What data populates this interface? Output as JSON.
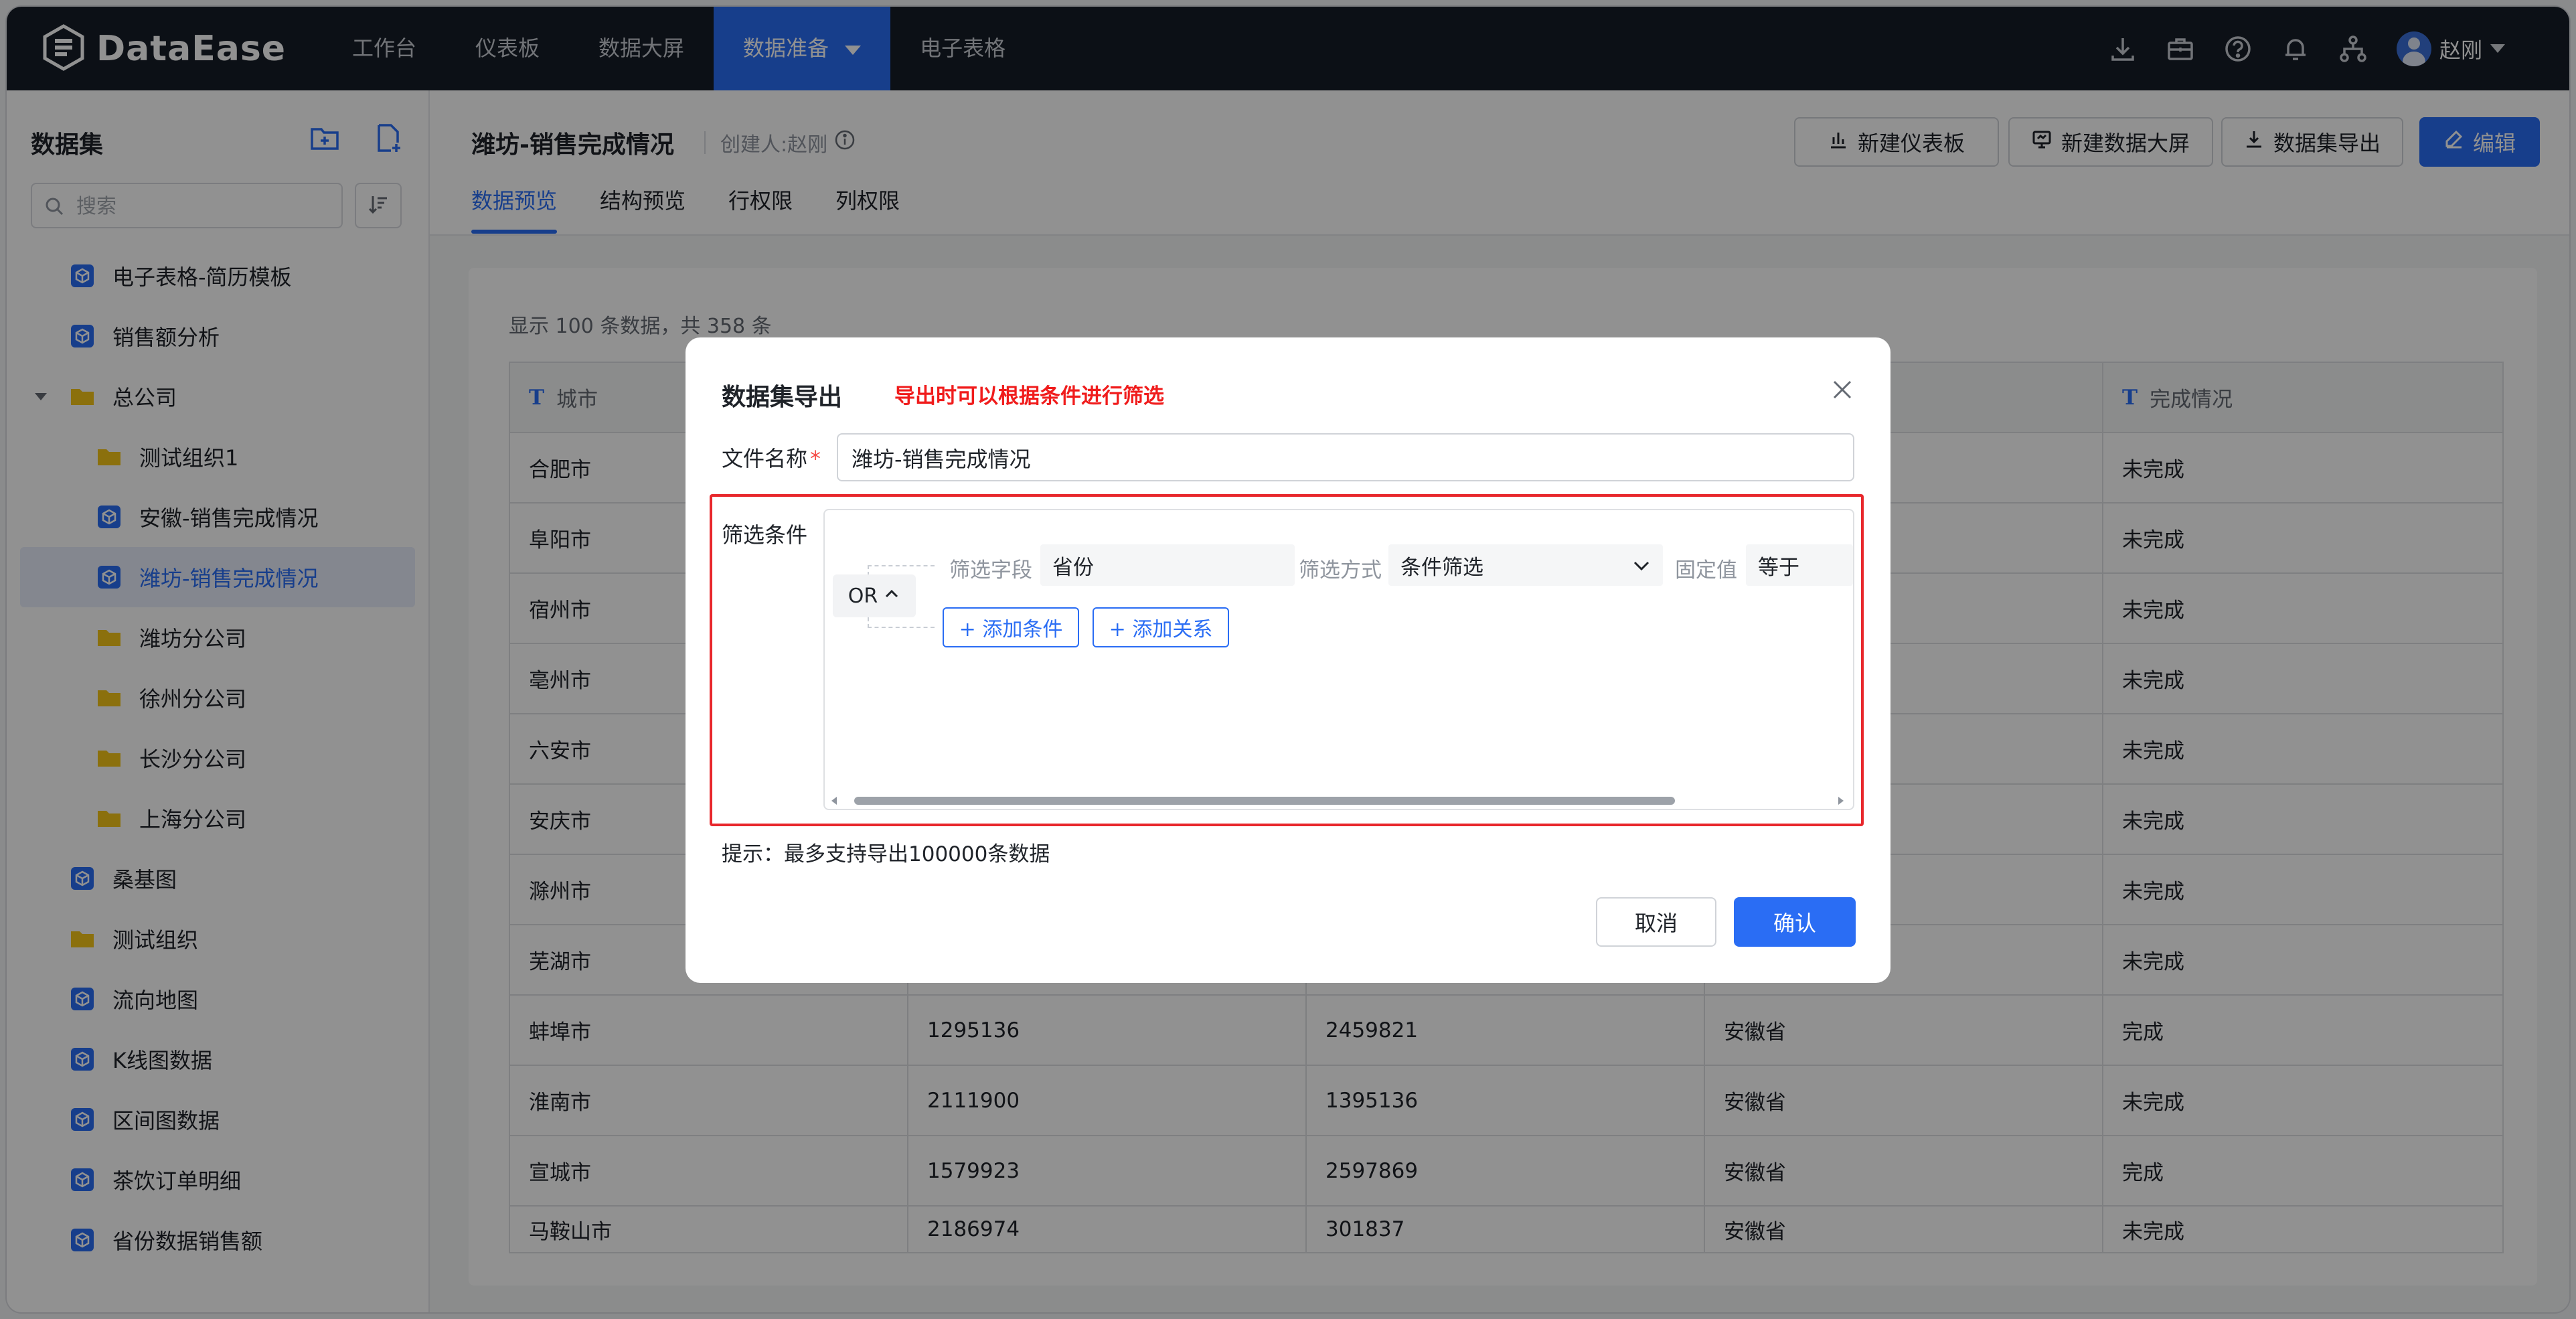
{
  "brand": {
    "name": "DataEase"
  },
  "nav": {
    "items": [
      "工作台",
      "仪表板",
      "数据大屏",
      "数据准备",
      "电子表格"
    ],
    "active_index": 3
  },
  "user": {
    "name": "赵刚"
  },
  "top_icons": [
    "download-icon",
    "briefcase-icon",
    "help-icon",
    "bell-icon",
    "org-tree-icon"
  ],
  "sidebar": {
    "title": "数据集",
    "search_placeholder": "搜索",
    "items": [
      {
        "label": "电子表格-简历模板",
        "type": "dataset",
        "level": 0
      },
      {
        "label": "销售额分析",
        "type": "dataset",
        "level": 0
      },
      {
        "label": "总公司",
        "type": "folder",
        "level": 0,
        "expanded": true
      },
      {
        "label": "测试组织1",
        "type": "folder",
        "level": 1
      },
      {
        "label": "安徽-销售完成情况",
        "type": "dataset",
        "level": 1
      },
      {
        "label": "潍坊-销售完成情况",
        "type": "dataset",
        "level": 1,
        "selected": true
      },
      {
        "label": "潍坊分公司",
        "type": "folder",
        "level": 1
      },
      {
        "label": "徐州分公司",
        "type": "folder",
        "level": 1
      },
      {
        "label": "长沙分公司",
        "type": "folder",
        "level": 1
      },
      {
        "label": "上海分公司",
        "type": "folder",
        "level": 1
      },
      {
        "label": "桑基图",
        "type": "dataset",
        "level": 0
      },
      {
        "label": "测试组织",
        "type": "folder",
        "level": 0
      },
      {
        "label": "流向地图",
        "type": "dataset",
        "level": 0
      },
      {
        "label": "K线图数据",
        "type": "dataset",
        "level": 0
      },
      {
        "label": "区间图数据",
        "type": "dataset",
        "level": 0
      },
      {
        "label": "茶饮订单明细",
        "type": "dataset",
        "level": 0
      },
      {
        "label": "省份数据销售额",
        "type": "dataset",
        "level": 0
      }
    ]
  },
  "dataset": {
    "title": "潍坊-销售完成情况",
    "creator": "创建人:赵刚",
    "buttons": {
      "new_dashboard": "新建仪表板",
      "new_screen": "新建数据大屏",
      "export": "数据集导出",
      "edit": "编辑"
    },
    "tabs": [
      "数据预览",
      "结构预览",
      "行权限",
      "列权限"
    ],
    "active_tab": 0
  },
  "preview": {
    "count_text": "显示 100 条数据，共 358 条",
    "columns": [
      "城市",
      "",
      "",
      "",
      "完成情况"
    ],
    "rows": [
      [
        "合肥市",
        "",
        "",
        "",
        "未完成"
      ],
      [
        "阜阳市",
        "",
        "",
        "",
        "未完成"
      ],
      [
        "宿州市",
        "",
        "",
        "",
        "未完成"
      ],
      [
        "亳州市",
        "",
        "",
        "",
        "未完成"
      ],
      [
        "六安市",
        "",
        "",
        "",
        "未完成"
      ],
      [
        "安庆市",
        "",
        "",
        "",
        "未完成"
      ],
      [
        "滁州市",
        "",
        "",
        "",
        "未完成"
      ],
      [
        "芜湖市",
        "",
        "",
        "",
        "未完成"
      ],
      [
        "蚌埠市",
        "1295136",
        "2459821",
        "安徽省",
        "完成"
      ],
      [
        "淮南市",
        "2111900",
        "1395136",
        "安徽省",
        "未完成"
      ],
      [
        "宣城市",
        "1579923",
        "2597869",
        "安徽省",
        "完成"
      ],
      [
        "马鞍山市",
        "2186974",
        "301837",
        "安徽省",
        "未完成"
      ]
    ]
  },
  "modal": {
    "title": "数据集导出",
    "note": "导出时可以根据条件进行筛选",
    "file_name_label": "文件名称",
    "file_name_value": "潍坊-销售完成情况",
    "filter_label": "筛选条件",
    "relation": "OR",
    "condition": {
      "field_label": "筛选字段",
      "field_value": "省份",
      "method_label": "筛选方式",
      "method_value": "条件筛选",
      "fixed_label": "固定值",
      "operator_value": "等于"
    },
    "add_condition": "+ 添加条件",
    "add_relation": "+ 添加关系",
    "hint": "提示：最多支持导出100000条数据",
    "cancel": "取消",
    "confirm": "确认"
  },
  "colors": {
    "primary": "#2a6df4",
    "topbar": "#161d27",
    "highlight_red": "#e8272c",
    "folder": "#f5c518"
  }
}
